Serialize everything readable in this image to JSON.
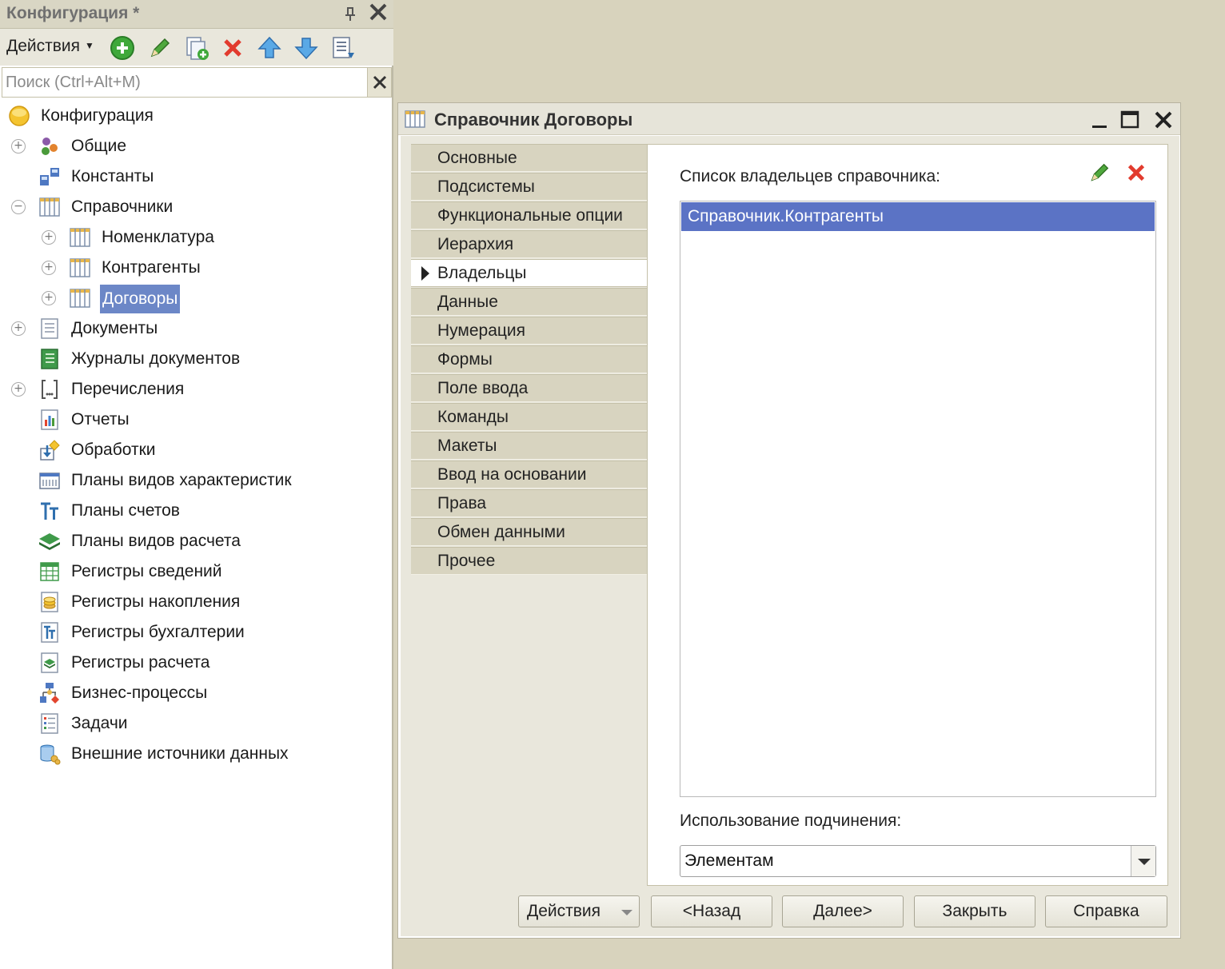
{
  "left_panel": {
    "title": "Конфигурация *",
    "toolbar": {
      "actions_label": "Действия"
    },
    "search": {
      "placeholder": "Поиск (Ctrl+Alt+M)",
      "value": ""
    },
    "tree": [
      {
        "label": "Конфигурация",
        "icon": "configuration-icon",
        "expander": "",
        "selected": false
      },
      {
        "label": "Общие",
        "icon": "common-icon",
        "expander": "plus",
        "selected": false
      },
      {
        "label": "Константы",
        "icon": "constants-icon",
        "expander": "",
        "selected": false
      },
      {
        "label": "Справочники",
        "icon": "catalog-icon",
        "expander": "minus",
        "selected": false
      },
      {
        "label": "Номенклатура",
        "icon": "catalog-icon",
        "expander": "plus",
        "selected": false
      },
      {
        "label": "Контрагенты",
        "icon": "catalog-icon",
        "expander": "plus",
        "selected": false
      },
      {
        "label": "Договоры",
        "icon": "catalog-icon",
        "expander": "plus",
        "selected": true
      },
      {
        "label": "Документы",
        "icon": "document-icon",
        "expander": "plus",
        "selected": false
      },
      {
        "label": "Журналы документов",
        "icon": "journal-icon",
        "expander": "",
        "selected": false
      },
      {
        "label": "Перечисления",
        "icon": "enum-icon",
        "expander": "plus",
        "selected": false
      },
      {
        "label": "Отчеты",
        "icon": "report-icon",
        "expander": "",
        "selected": false
      },
      {
        "label": "Обработки",
        "icon": "processing-icon",
        "expander": "",
        "selected": false
      },
      {
        "label": "Планы видов характеристик",
        "icon": "characteristics-icon",
        "expander": "",
        "selected": false
      },
      {
        "label": "Планы счетов",
        "icon": "chart-of-accounts-icon",
        "expander": "",
        "selected": false
      },
      {
        "label": "Планы видов расчета",
        "icon": "calculation-types-icon",
        "expander": "",
        "selected": false
      },
      {
        "label": "Регистры сведений",
        "icon": "info-register-icon",
        "expander": "",
        "selected": false
      },
      {
        "label": "Регистры накопления",
        "icon": "accumulation-register-icon",
        "expander": "",
        "selected": false
      },
      {
        "label": "Регистры бухгалтерии",
        "icon": "accounting-register-icon",
        "expander": "",
        "selected": false
      },
      {
        "label": "Регистры расчета",
        "icon": "calculation-register-icon",
        "expander": "",
        "selected": false
      },
      {
        "label": "Бизнес-процессы",
        "icon": "business-process-icon",
        "expander": "",
        "selected": false
      },
      {
        "label": "Задачи",
        "icon": "tasks-icon",
        "expander": "",
        "selected": false
      },
      {
        "label": "Внешние источники данных",
        "icon": "external-data-icon",
        "expander": "",
        "selected": false
      }
    ]
  },
  "dialog": {
    "title": "Справочник Договоры",
    "tabs": [
      {
        "label": "Основные",
        "active": false
      },
      {
        "label": "Подсистемы",
        "active": false
      },
      {
        "label": "Функциональные опции",
        "active": false
      },
      {
        "label": "Иерархия",
        "active": false
      },
      {
        "label": "Владельцы",
        "active": true
      },
      {
        "label": "Данные",
        "active": false
      },
      {
        "label": "Нумерация",
        "active": false
      },
      {
        "label": "Формы",
        "active": false
      },
      {
        "label": "Поле ввода",
        "active": false
      },
      {
        "label": "Команды",
        "active": false
      },
      {
        "label": "Макеты",
        "active": false
      },
      {
        "label": "Ввод на основании",
        "active": false
      },
      {
        "label": "Права",
        "active": false
      },
      {
        "label": "Обмен данными",
        "active": false
      },
      {
        "label": "Прочее",
        "active": false
      }
    ],
    "owners": {
      "label": "Список владельцев справочника:",
      "items": [
        "Справочник.Контрагенты"
      ]
    },
    "subordination": {
      "label": "Использование подчинения:",
      "value": "Элементам"
    },
    "buttons": {
      "actions": "Действия",
      "back": "<Назад",
      "next": "Далее>",
      "close": "Закрыть",
      "help": "Справка"
    }
  },
  "colors": {
    "selection": "#5b73c5",
    "tree_selection": "#6c87c7",
    "panel_background": "#e9e7dc",
    "desktop": "#d8d3bd"
  }
}
